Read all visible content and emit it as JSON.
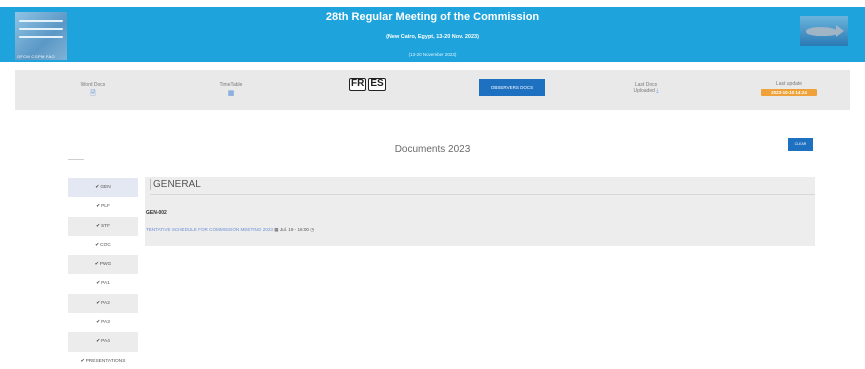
{
  "header": {
    "title": "28th Regular Meeting of the Commission",
    "subtitle": "(New Cairo, Egypt, 13-20 Nov. 2023)",
    "dates": "(13-20 November 2023)",
    "logo_text": "GFCM CGPM FAO",
    "banner_color": "#1ea3dc"
  },
  "toolbar": {
    "word_docs": {
      "label": "Word Docs",
      "icon": "file-word-icon"
    },
    "timetable": {
      "label": "TimeTable",
      "icon": "calendar-icon"
    },
    "languages": [
      "FR",
      "ES"
    ],
    "observers_button": "OBSERVERS DOCS",
    "last_docs": {
      "label": "Last Docs",
      "sub": "Uploaded",
      "icon": "download-icon"
    },
    "last_update": {
      "label": "Last update",
      "value": "2023-10-10 14:24",
      "badge_color": "#f0a23a"
    }
  },
  "main": {
    "heading": "Documents 2023",
    "clear_button": "CLEAR"
  },
  "sidebar": {
    "items": [
      "GEN",
      "PLF",
      "STF",
      "COC",
      "PWG",
      "PA1",
      "PA2",
      "PA3",
      "PA4",
      "PRESENTATIONS"
    ]
  },
  "panel": {
    "title": "GENERAL",
    "doc_code": "GEN-002",
    "doc_title": "TENTATIVE SCHEDULE FOR COMMISSION MEETING 2023",
    "doc_date": "Jul. 19 - 16:00"
  }
}
